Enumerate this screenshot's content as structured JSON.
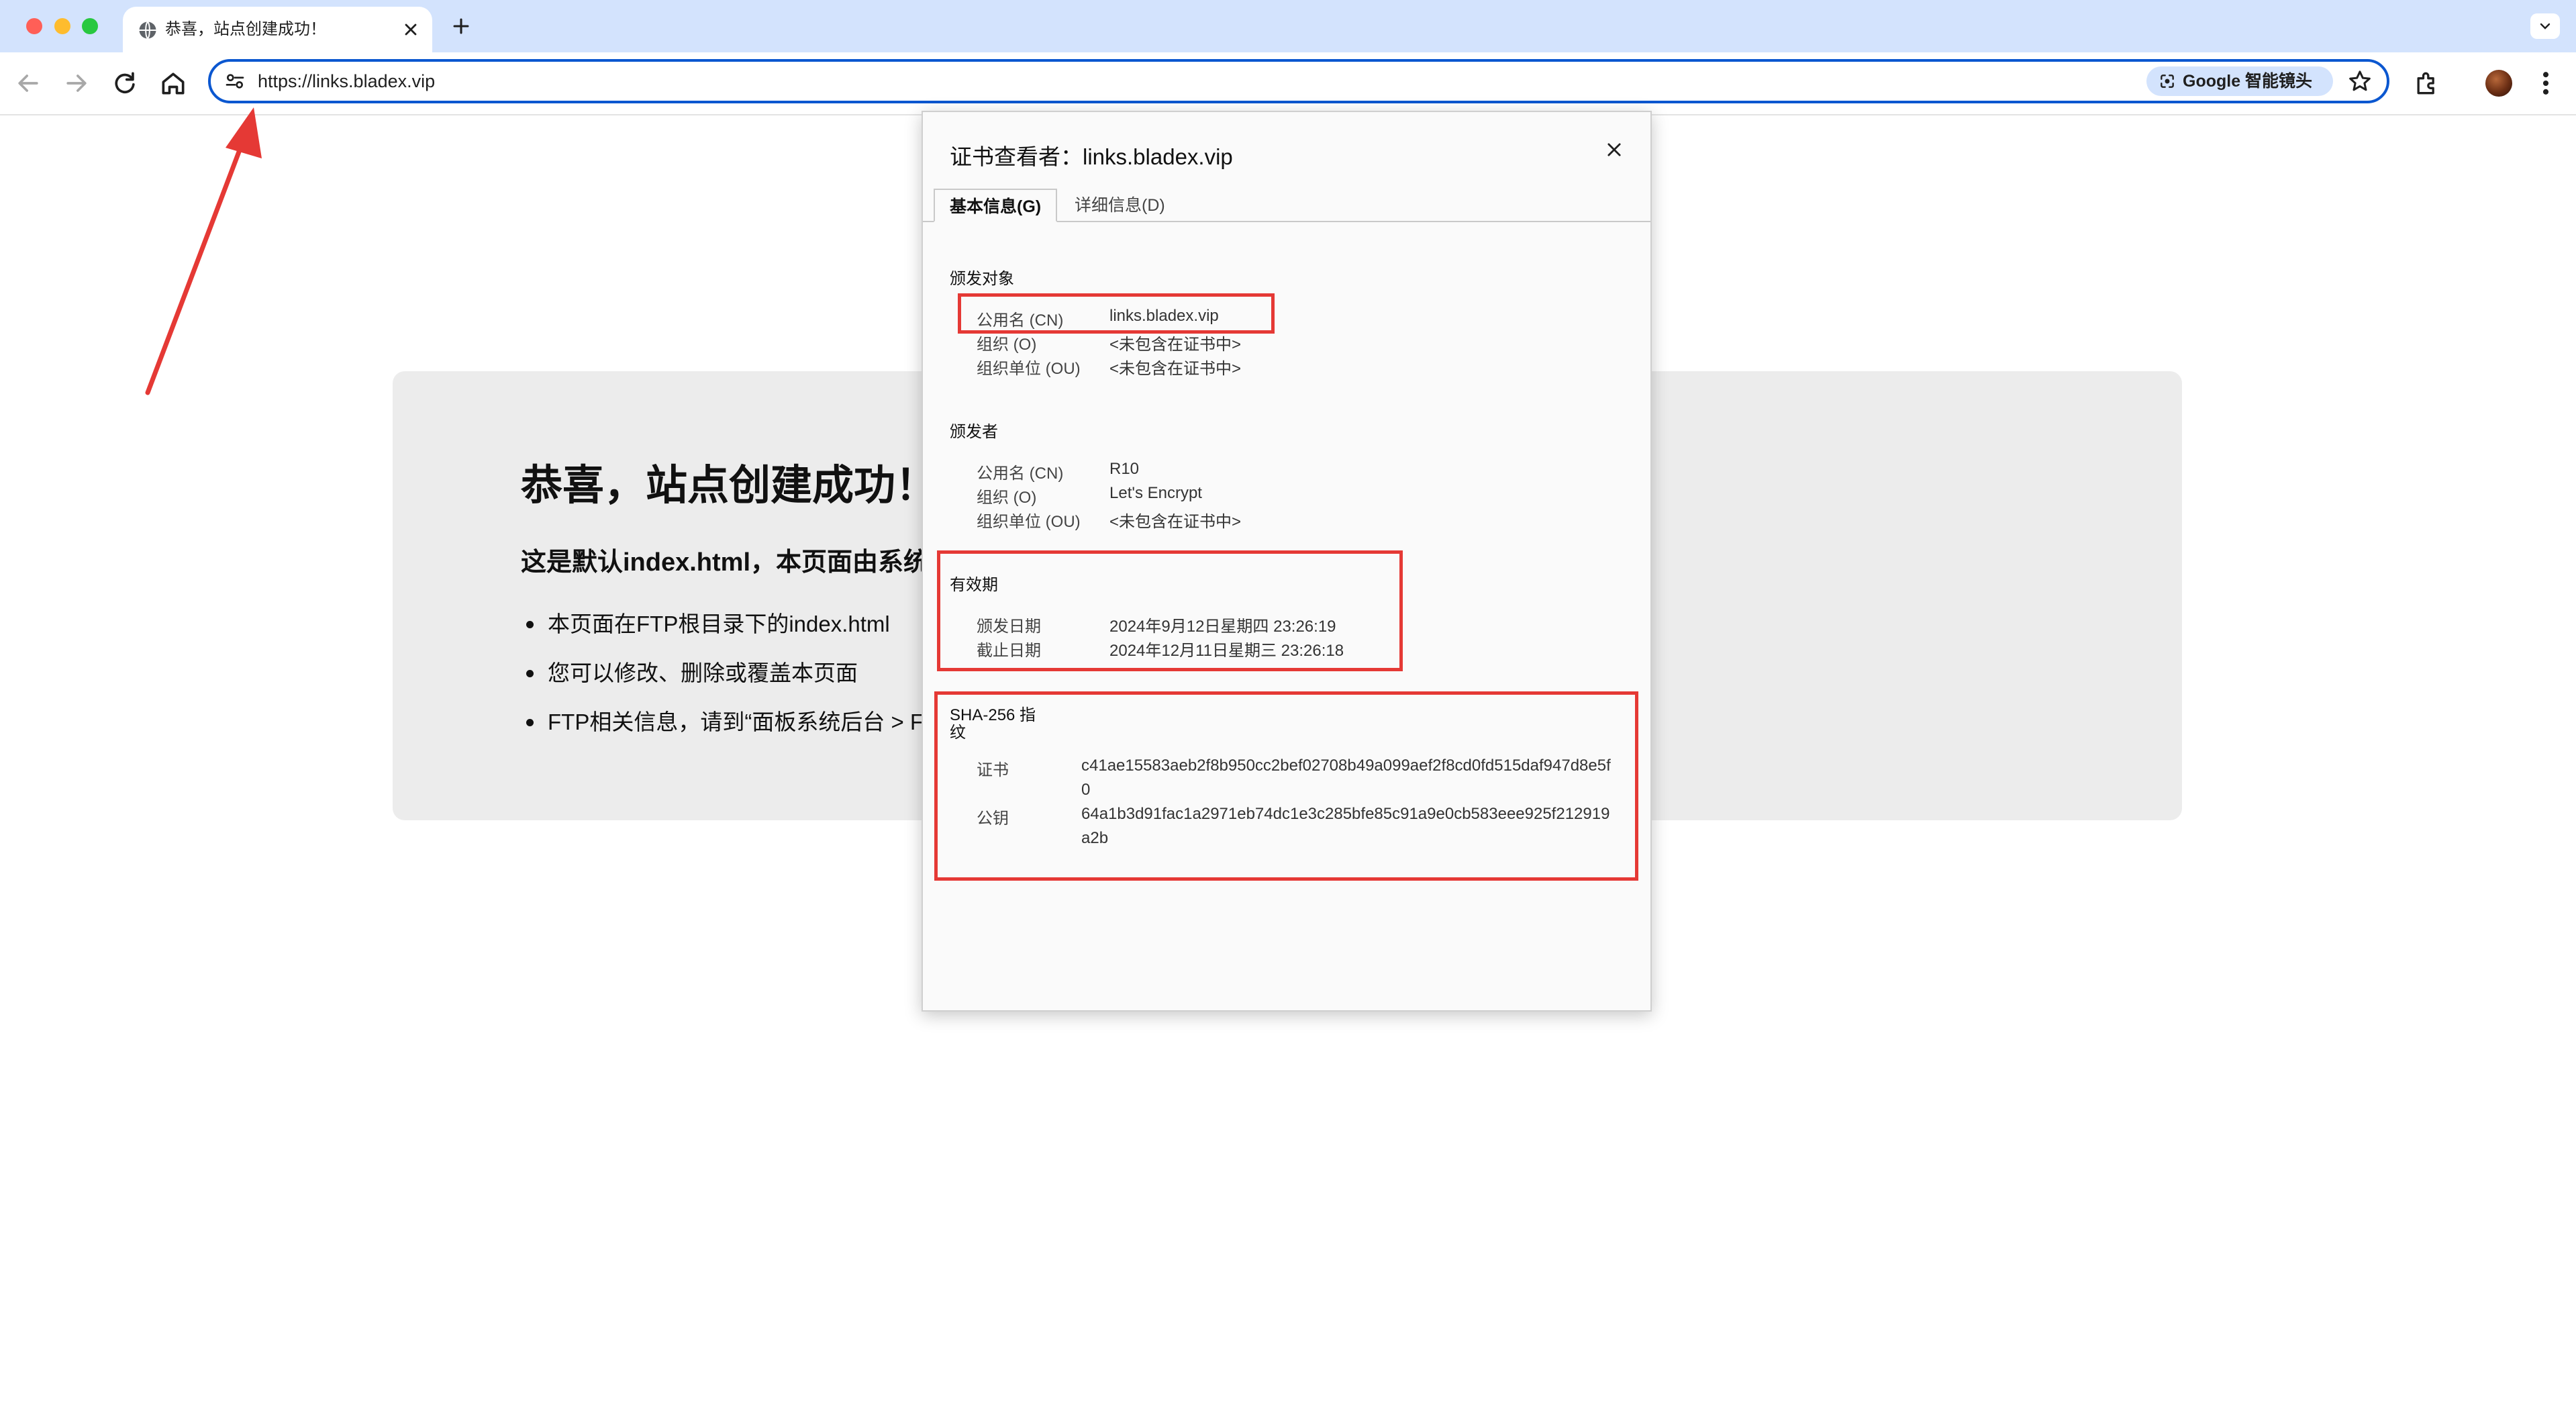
{
  "browser": {
    "tab": {
      "title": "恭喜，站点创建成功！"
    },
    "address_bar": {
      "url": "https://links.bladex.vip"
    },
    "lens_button": {
      "label": "Google 智能镜头"
    }
  },
  "page": {
    "heading": "恭喜，站点创建成功！",
    "subheading": "这是默认index.html，本页面由系统",
    "bullets": [
      "本页面在FTP根目录下的index.html",
      "您可以修改、删除或覆盖本页面",
      "FTP相关信息，请到“面板系统后台 > F"
    ]
  },
  "certificate_viewer": {
    "title": "证书查看者：links.bladex.vip",
    "tabs": [
      "基本信息(G)",
      "详细信息(D)"
    ],
    "issued_to": {
      "heading": "颁发对象",
      "rows": [
        {
          "label": "公用名 (CN)",
          "value": "links.bladex.vip"
        },
        {
          "label": "组织 (O)",
          "value": "<未包含在证书中>"
        },
        {
          "label": "组织单位 (OU)",
          "value": "<未包含在证书中>"
        }
      ]
    },
    "issued_by": {
      "heading": "颁发者",
      "rows": [
        {
          "label": "公用名 (CN)",
          "value": "R10"
        },
        {
          "label": "组织 (O)",
          "value": "Let's Encrypt"
        },
        {
          "label": "组织单位 (OU)",
          "value": "<未包含在证书中>"
        }
      ]
    },
    "validity": {
      "heading": "有效期",
      "rows": [
        {
          "label": "颁发日期",
          "value": "2024年9月12日星期四 23:26:19"
        },
        {
          "label": "截止日期",
          "value": "2024年12月11日星期三 23:26:18"
        }
      ]
    },
    "fingerprints": {
      "heading_line1": "SHA-256 指",
      "heading_line2": "纹",
      "rows": [
        {
          "label": "证书",
          "value": "c41ae15583aeb2f8b950cc2bef02708b49a099aef2f8cd0fd515daf947d8e5f0"
        },
        {
          "label": "公钥",
          "value": "64a1b3d91fac1a2971eb74dc1e3c285bfe85c91a9e0cb583eee925f212919a2b"
        }
      ]
    }
  },
  "colors": {
    "accent": "#0b57d0",
    "annotation_red": "#e53935",
    "tab_strip": "#d3e3fd"
  }
}
